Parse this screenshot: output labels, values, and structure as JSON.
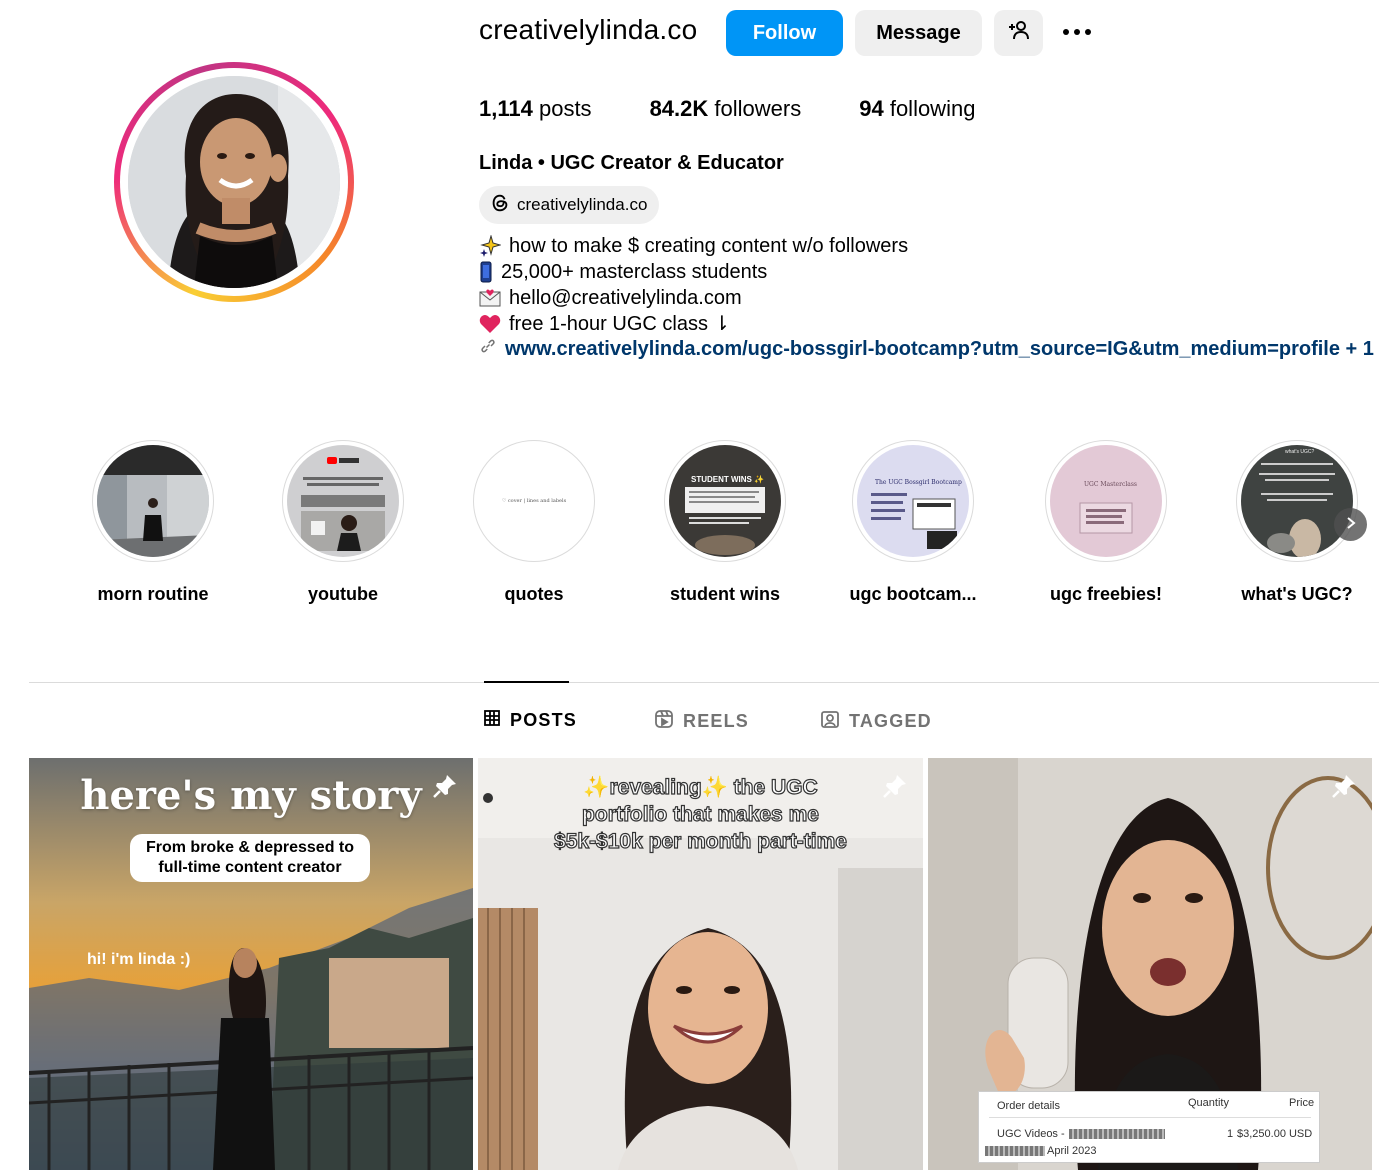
{
  "profile": {
    "username": "creativelylinda.co",
    "follow_label": "Follow",
    "message_label": "Message",
    "stats": {
      "posts_count": "1,114",
      "posts_label": "posts",
      "followers_count": "84.2K",
      "followers_label": "followers",
      "following_count": "94",
      "following_label": "following"
    },
    "full_name": "Linda • UGC Creator & Educator",
    "threads_handle": "creativelylinda.co",
    "bio": [
      {
        "icon": "sparkles-icon",
        "text": "how to make $ creating content w/o followers"
      },
      {
        "icon": "phone-icon",
        "text": "25,000+ masterclass students"
      },
      {
        "icon": "envelope-icon",
        "text": "hello@creativelylinda.com"
      },
      {
        "icon": "heart-icon",
        "text": "free 1-hour UGC class ⇂"
      }
    ],
    "link": "www.creativelylinda.com/ugc-bossgirl-bootcamp?utm_source=IG&utm_medium=profile + 1"
  },
  "highlights": [
    {
      "label": "morn routine"
    },
    {
      "label": "youtube"
    },
    {
      "label": "quotes",
      "inner_text": "♡ cover | lines and labels"
    },
    {
      "label": "student wins",
      "inner_text": "STUDENT WINS ✨"
    },
    {
      "label": "ugc bootcam...",
      "inner_text": "The UGC Bossgirl Bootcamp"
    },
    {
      "label": "ugc freebies!",
      "inner_text": "UGC Masterclass"
    },
    {
      "label": "what's UGC?",
      "inner_text": "what's UGC?"
    }
  ],
  "tabs": [
    {
      "label": "POSTS",
      "icon": "grid-icon",
      "active": true
    },
    {
      "label": "REELS",
      "icon": "reels-icon",
      "active": false
    },
    {
      "label": "TAGGED",
      "icon": "tagged-icon",
      "active": false
    }
  ],
  "posts": [
    {
      "title": "here's my story",
      "subtitle": "From broke & depressed to full-time content creator",
      "caption": "hi! i'm linda :)"
    },
    {
      "title": "✨revealing✨ the UGC portfolio that makes me $5k-$10k per month part-time"
    },
    {
      "order": {
        "heading": "Order details",
        "quantity_label": "Quantity",
        "price_label": "Price",
        "item": "UGC Videos -",
        "quantity": "1",
        "price": "$3,250.00 USD",
        "date": "April 2023"
      }
    }
  ],
  "colors": {
    "follow_blue": "#0095f6",
    "link_blue": "#00376b",
    "button_gray": "#efefef"
  }
}
